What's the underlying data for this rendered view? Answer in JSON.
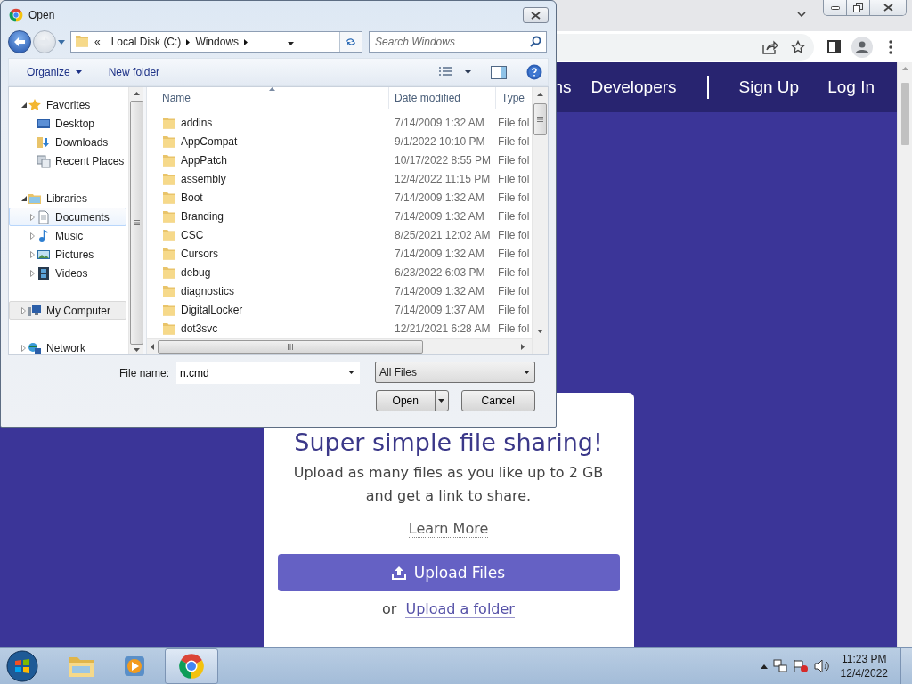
{
  "browser": {
    "nav_links": [
      {
        "label": "ns"
      },
      {
        "label": "Developers"
      },
      {
        "label": "Sign Up"
      },
      {
        "label": "Log In"
      }
    ],
    "card": {
      "title": "Super simple file sharing!",
      "description": "Upload as many files as you like up to 2 GB and get a link to share.",
      "learn_more": "Learn More",
      "upload_button": "Upload Files",
      "folder_prefix": "or",
      "folder_link": "Upload a folder"
    }
  },
  "dialog": {
    "title": "Open",
    "breadcrumb": {
      "overflow": "«",
      "parts": [
        "Local Disk (C:)",
        "Windows"
      ]
    },
    "search": {
      "placeholder": "Search Windows"
    },
    "toolbar": [
      "Organize",
      "New folder"
    ],
    "nav_tree": [
      {
        "label": "Favorites",
        "kind": "star",
        "expanded": true,
        "selected": false,
        "children": [
          {
            "label": "Desktop",
            "kind": "desktop",
            "selected": false
          },
          {
            "label": "Downloads",
            "kind": "downloads",
            "selected": false
          },
          {
            "label": "Recent Places",
            "kind": "recent",
            "selected": false
          }
        ]
      },
      {
        "label": "Libraries",
        "kind": "library",
        "expanded": true,
        "selected": false,
        "children": [
          {
            "label": "Documents",
            "kind": "documents",
            "expanded": false,
            "selected": false,
            "hovered": true
          },
          {
            "label": "Music",
            "kind": "music",
            "expanded": false,
            "selected": false
          },
          {
            "label": "Pictures",
            "kind": "pictures",
            "expanded": false,
            "selected": false
          },
          {
            "label": "Videos",
            "kind": "videos",
            "expanded": false,
            "selected": false
          }
        ]
      },
      {
        "label": "My Computer",
        "kind": "computer",
        "expanded": false,
        "selected": true
      },
      {
        "label": "Network",
        "kind": "network",
        "expanded": false,
        "selected": false
      }
    ],
    "columns": [
      "Name",
      "Date modified",
      "Type"
    ],
    "files": [
      {
        "name": "addins",
        "date": "7/14/2009 1:32 AM",
        "type": "File fol"
      },
      {
        "name": "AppCompat",
        "date": "9/1/2022 10:10 PM",
        "type": "File fol"
      },
      {
        "name": "AppPatch",
        "date": "10/17/2022 8:55 PM",
        "type": "File fol"
      },
      {
        "name": "assembly",
        "date": "12/4/2022 11:15 PM",
        "type": "File fol"
      },
      {
        "name": "Boot",
        "date": "7/14/2009 1:32 AM",
        "type": "File fol"
      },
      {
        "name": "Branding",
        "date": "7/14/2009 1:32 AM",
        "type": "File fol"
      },
      {
        "name": "CSC",
        "date": "8/25/2021 12:02 AM",
        "type": "File fol"
      },
      {
        "name": "Cursors",
        "date": "7/14/2009 1:32 AM",
        "type": "File fol"
      },
      {
        "name": "debug",
        "date": "6/23/2022 6:03 PM",
        "type": "File fol"
      },
      {
        "name": "diagnostics",
        "date": "7/14/2009 1:32 AM",
        "type": "File fol"
      },
      {
        "name": "DigitalLocker",
        "date": "7/14/2009 1:37 AM",
        "type": "File fol"
      },
      {
        "name": "dot3svc",
        "date": "12/21/2021 6:28 AM",
        "type": "File fol"
      }
    ],
    "file_name": {
      "label": "File name:",
      "value": "n.cmd"
    },
    "file_type": "All Files",
    "buttons": [
      "Open",
      "Cancel"
    ]
  },
  "taskbar": {
    "apps": [
      {
        "kind": "explorer",
        "active": false
      },
      {
        "kind": "media",
        "active": false
      },
      {
        "kind": "chrome",
        "active": true
      }
    ],
    "clock": {
      "time": "11:23 PM",
      "date": "12/4/2022"
    }
  }
}
